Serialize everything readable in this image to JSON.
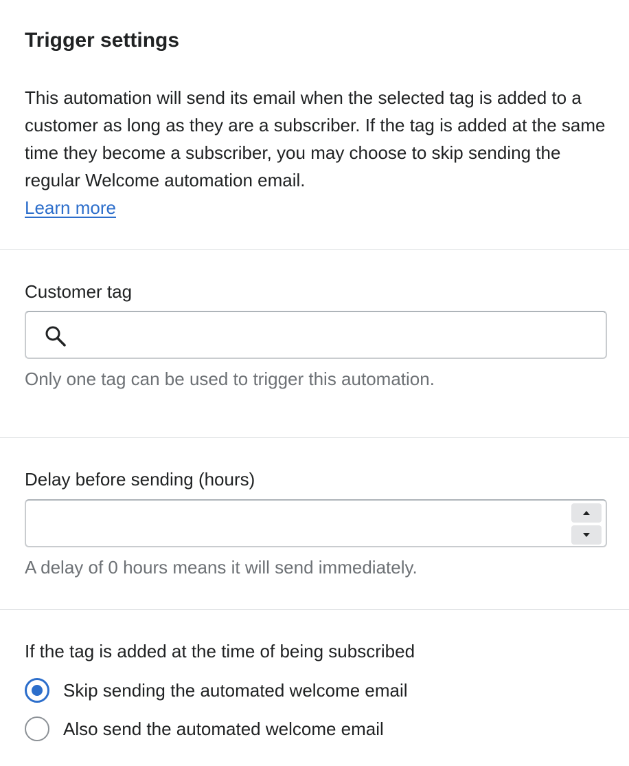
{
  "trigger": {
    "heading": "Trigger settings",
    "description": "This automation will send its email when the selected tag is added to a customer as long as they are a subscriber. If the tag is added at the same time they become a subscriber, you may choose to skip sending the regular Welcome automation email.",
    "learn_more": "Learn more"
  },
  "customer_tag": {
    "label": "Customer tag",
    "value": "",
    "placeholder": "",
    "help_text": "Only one tag can be used to trigger this automation.",
    "icon": "search-icon"
  },
  "delay": {
    "label": "Delay before sending (hours)",
    "value": "",
    "help_text": "A delay of 0 hours means it will send immediately.",
    "increment_icon": "caret-up-icon",
    "decrement_icon": "caret-down-icon"
  },
  "subscribed": {
    "label": "If the tag is added at the time of being subscribed",
    "options": [
      {
        "label": "Skip sending the automated welcome email",
        "checked": true
      },
      {
        "label": "Also send the automated welcome email",
        "checked": false
      }
    ]
  },
  "colors": {
    "text": "#202223",
    "subdued_text": "#6d7175",
    "link": "#2c6ecb",
    "accent": "#2c6ecb",
    "divider": "#e1e3e5",
    "border": "#c9cccf"
  }
}
